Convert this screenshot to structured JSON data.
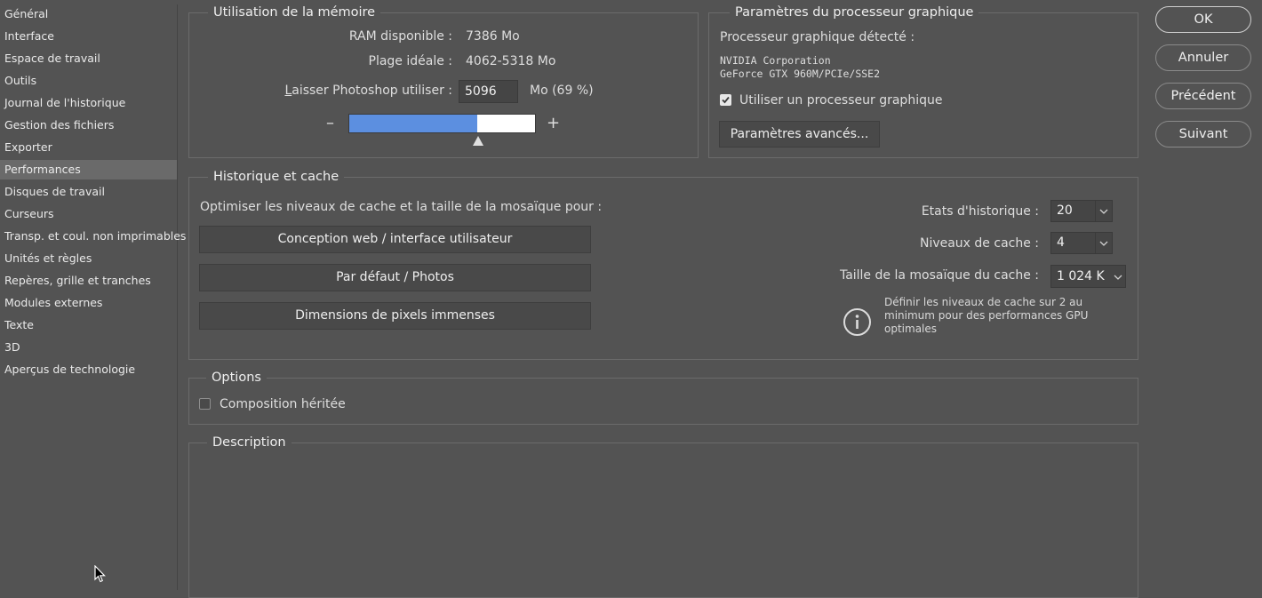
{
  "sidebar": {
    "items": [
      "Général",
      "Interface",
      "Espace de travail",
      "Outils",
      "Journal de l'historique",
      "Gestion des fichiers",
      "Exporter",
      "Performances",
      "Disques de travail",
      "Curseurs",
      "Transp. et coul. non imprimables",
      "Unités et règles",
      "Repères, grille et tranches",
      "Modules externes",
      "Texte",
      "3D",
      "Aperçus de technologie"
    ],
    "selected_index": 7
  },
  "memory": {
    "title": "Utilisation de la mémoire",
    "ram_label": "RAM disponible :",
    "ram_value": "7386 Mo",
    "range_label": "Plage idéale :",
    "range_value": "4062-5318 Mo",
    "let_label": "Laisser Photoshop utiliser :",
    "let_value": "5096",
    "let_unit": "Mo (69 %)",
    "slider_fraction": 0.69,
    "minus": "–",
    "plus": "+"
  },
  "gpu": {
    "title": "Paramètres du processeur graphique",
    "detected_label": "Processeur graphique détecté :",
    "vendor": "NVIDIA Corporation",
    "model": "GeForce GTX 960M/PCIe/SSE2",
    "use_gpu_label": "Utiliser un processeur graphique",
    "use_gpu_checked": true,
    "advanced_button": "Paramètres avancés..."
  },
  "cache": {
    "title": "Historique et cache",
    "optimize_label": "Optimiser les niveaux de cache et la taille de la mosaïque pour :",
    "preset_buttons": [
      "Conception web / interface utilisateur",
      "Par défaut / Photos",
      "Dimensions de pixels immenses"
    ],
    "history_label": "Etats d'historique :",
    "history_value": "20",
    "levels_label": "Niveaux de cache :",
    "levels_value": "4",
    "tile_label": "Taille de la mosaïque du cache :",
    "tile_value": "1 024 K",
    "info_text": "Définir les niveaux de cache sur 2 au minimum pour des performances GPU optimales"
  },
  "options": {
    "title": "Options",
    "legacy_label": "Composition héritée",
    "legacy_checked": false
  },
  "description": {
    "title": "Description"
  },
  "buttons": {
    "ok": "OK",
    "cancel": "Annuler",
    "prev": "Précédent",
    "next": "Suivant"
  },
  "colors": {
    "background": "#535353",
    "slider_fill": "#5c8fe0",
    "slider_empty": "#ffffff"
  }
}
